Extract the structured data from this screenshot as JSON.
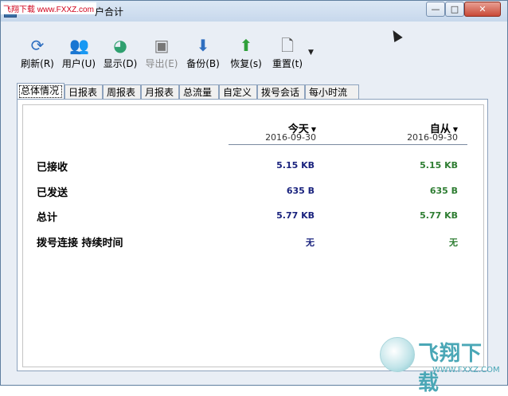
{
  "window": {
    "brand_tag": "飞翔下载 www.FXXZ.com",
    "title": "户合计"
  },
  "toolbar": {
    "items": [
      {
        "label": "刷新(R)",
        "icon": "refresh-icon",
        "glyph": "⟳",
        "color": "#2f6fc0"
      },
      {
        "label": "用户(U)",
        "icon": "users-icon",
        "glyph": "👥",
        "color": "#c0702f"
      },
      {
        "label": "显示(D)",
        "icon": "display-icon",
        "glyph": "◕",
        "color": "#2fa06f"
      },
      {
        "label": "导出(E)",
        "icon": "save-icon",
        "glyph": "▣",
        "color": "#777777"
      },
      {
        "label": "备份(B)",
        "icon": "backup-arrow-down-icon",
        "glyph": "⬇",
        "color": "#2f6fc0"
      },
      {
        "label": "恢复(s)",
        "icon": "restore-arrow-up-icon",
        "glyph": "⬆",
        "color": "#2fa03a"
      },
      {
        "label": "重置(t)",
        "icon": "reset-document-icon",
        "glyph": "🗋",
        "color": "#555555"
      }
    ],
    "more_glyph": "▼"
  },
  "tabs": [
    "总体情况",
    "日报表",
    "周报表",
    "月报表",
    "总流量",
    "自定义",
    "拨号会话",
    "每小时流量"
  ],
  "columns": {
    "today": {
      "title": "今天",
      "date": "2016-09-30"
    },
    "since": {
      "title": "自从",
      "date": "2016-09-30"
    },
    "caret": "▼"
  },
  "rows": [
    {
      "label": "已接收",
      "today": "5.15 KB",
      "since": "5.15 KB"
    },
    {
      "label": "已发送",
      "today": "635 B",
      "since": "635 B"
    },
    {
      "label": "总计",
      "today": "5.77 KB",
      "since": "5.77 KB"
    },
    {
      "label": "拨号连接 持续时间",
      "today": "无",
      "since": "无"
    }
  ],
  "watermark": {
    "text": "飞翔下载",
    "url": "WWW.FXXZ.COM"
  }
}
